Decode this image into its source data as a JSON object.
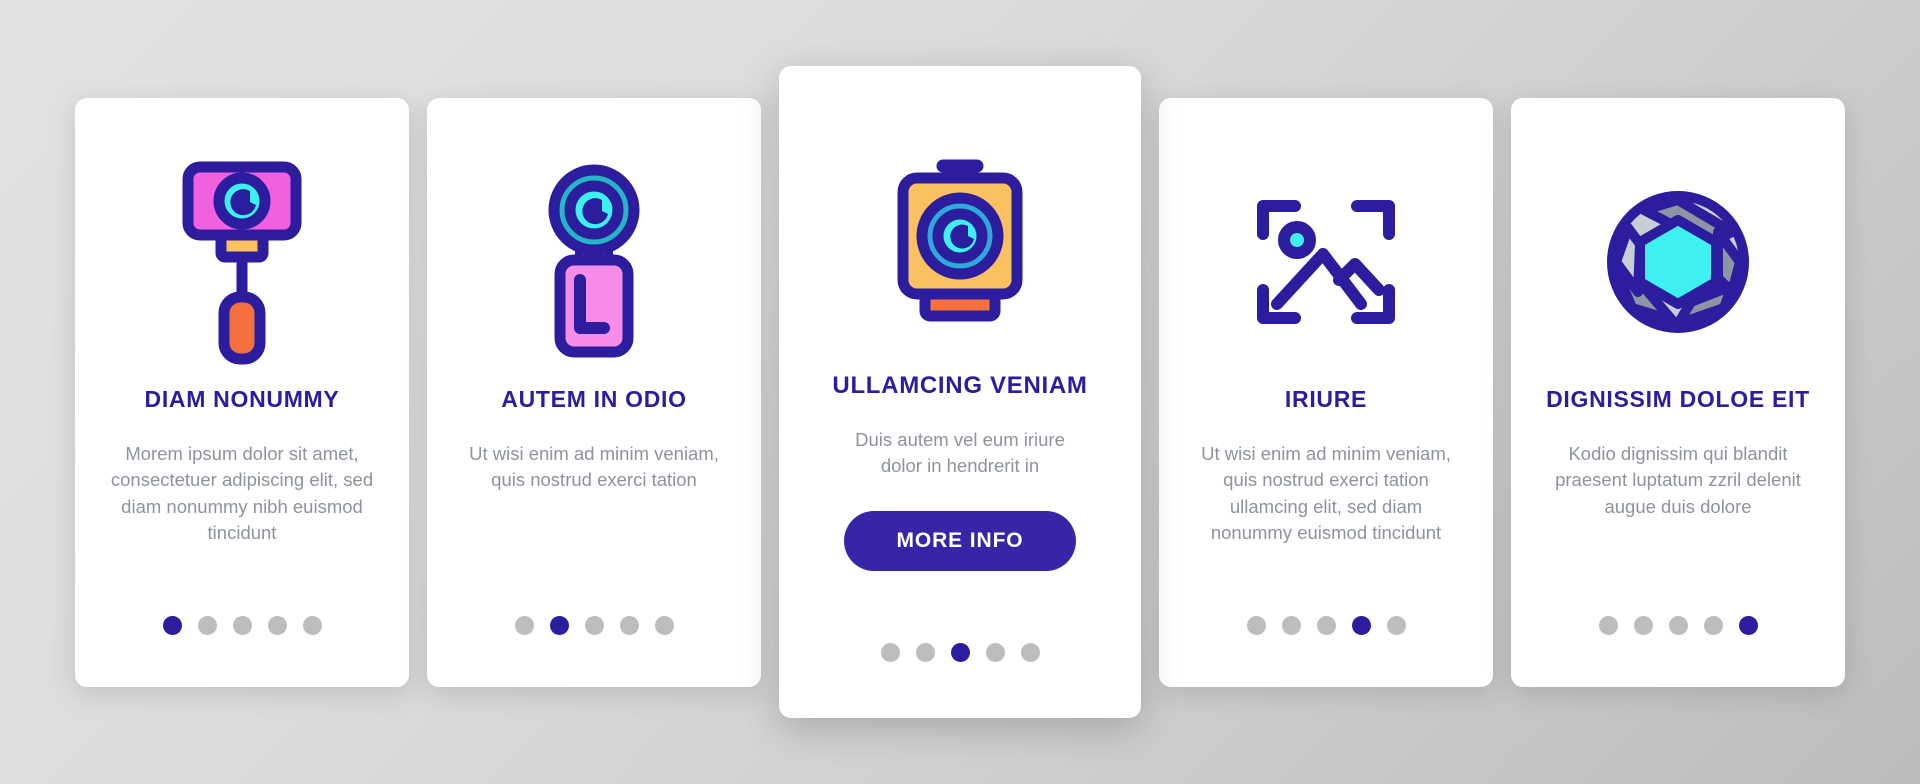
{
  "colors": {
    "accent": "#2b1d9e",
    "button": "#3526a8",
    "body_text": "#8e939c",
    "dot_inactive": "#bdbdbd",
    "card_bg": "#ffffff",
    "icon_outline": "#2b1d9e",
    "pink": "#f060df",
    "light_pink": "#f78ce8",
    "cyan": "#3ef0f0",
    "teal": "#24b6c4",
    "blue": "#2fa8dc",
    "yellow": "#fbc060",
    "orange": "#f4713f",
    "gray_blade": "#8b95a3",
    "gray_blade_light": "#c7ced6"
  },
  "cards": [
    {
      "icon": "selfie-stick-icon",
      "title": "DIAM NONUMMY",
      "description": "Morem ipsum dolor sit amet, consectetuer adipiscing elit, sed diam nonummy nibh euismod tincidunt",
      "featured": false,
      "cta": null,
      "dots": {
        "count": 5,
        "active_index": 0
      }
    },
    {
      "icon": "camera-lens-stand-icon",
      "title": "AUTEM IN ODIO",
      "description": "Ut wisi enim ad minim veniam, quis nostrud exerci tation",
      "featured": false,
      "cta": null,
      "dots": {
        "count": 5,
        "active_index": 1
      }
    },
    {
      "icon": "camera-body-icon",
      "title": "ULLAMCING VENIAM",
      "description": "Duis autem vel eum iriure dolor in hendrerit in",
      "featured": true,
      "cta": "MORE INFO",
      "dots": {
        "count": 5,
        "active_index": 2
      }
    },
    {
      "icon": "photo-frame-landscape-icon",
      "title": "IRIURE",
      "description": "Ut wisi enim ad minim veniam, quis nostrud exerci tation ullamcing elit, sed diam nonummy euismod tincidunt",
      "featured": false,
      "cta": null,
      "dots": {
        "count": 5,
        "active_index": 3
      }
    },
    {
      "icon": "aperture-icon",
      "title": "DIGNISSIM DOLOE EIT",
      "description": "Kodio dignissim qui blandit praesent luptatum zzril delenit augue duis dolore",
      "featured": false,
      "cta": null,
      "dots": {
        "count": 5,
        "active_index": 4
      }
    }
  ]
}
